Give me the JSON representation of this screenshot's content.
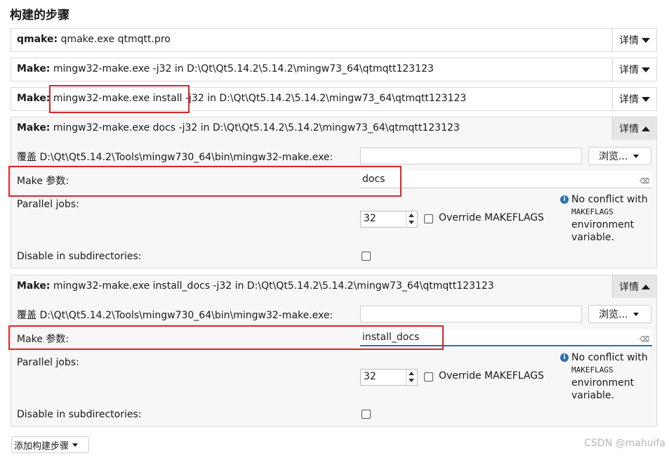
{
  "section_title": "构建的步骤",
  "details_label": "详情",
  "steps": [
    {
      "kind": "qmake:",
      "command": " qmake.exe qtmqtt.pro"
    },
    {
      "kind": "Make:",
      "command": " mingw32-make.exe -j32 in D:\\Qt\\Qt5.14.2\\5.14.2\\mingw73_64\\qtmqtt123123"
    },
    {
      "kind": "Make:",
      "command": " mingw32-make.exe install -j32 in D:\\Qt\\Qt5.14.2\\5.14.2\\mingw73_64\\qtmqtt123123"
    },
    {
      "kind": "Make:",
      "command": " mingw32-make.exe docs -j32 in D:\\Qt\\Qt5.14.2\\5.14.2\\mingw73_64\\qtmqtt123123",
      "override_label": "覆盖 D:\\Qt\\Qt5.14.2\\Tools\\mingw730_64\\bin\\mingw32-make.exe:",
      "override_value": "",
      "browse_label": "浏览...",
      "make_args_label": "Make 参数:",
      "make_args_value": "docs",
      "parallel_label": "Parallel jobs:",
      "parallel_value": "32",
      "override_makeflags_label": "Override MAKEFLAGS",
      "note_line1": "No conflict with",
      "note_line2": "MAKEFLAGS",
      "note_line3": "environment",
      "note_line4": "variable.",
      "disable_label": "Disable in subdirectories:"
    },
    {
      "kind": "Make:",
      "command": " mingw32-make.exe install_docs -j32 in D:\\Qt\\Qt5.14.2\\5.14.2\\mingw73_64\\qtmqtt123123",
      "override_label": "覆盖 D:\\Qt\\Qt5.14.2\\Tools\\mingw730_64\\bin\\mingw32-make.exe:",
      "override_value": "",
      "browse_label": "浏览...",
      "make_args_label": "Make 参数:",
      "make_args_value": "install_docs",
      "parallel_label": "Parallel jobs:",
      "parallel_value": "32",
      "override_makeflags_label": "Override MAKEFLAGS",
      "note_line1": "No conflict with",
      "note_line2": "MAKEFLAGS",
      "note_line3": "environment",
      "note_line4": "variable.",
      "disable_label": "Disable in subdirectories:"
    }
  ],
  "clear_icon_glyph": "⌫",
  "add_step_label": "添加构建步骤",
  "watermark": "CSDN @mahuifa",
  "colors": {
    "highlight_box": "#d9252a",
    "focus_underline": "#2f6fb0"
  }
}
